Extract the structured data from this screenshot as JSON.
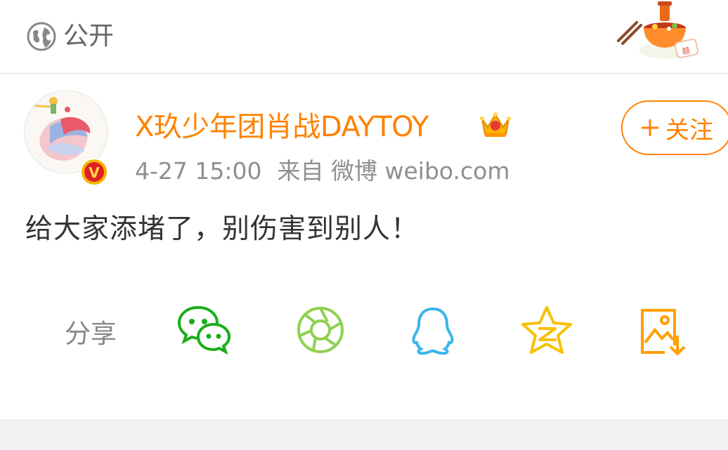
{
  "header": {
    "visibility_icon": "globe-icon",
    "visibility_label": "公开",
    "decoration_icon": "hotpot-icon"
  },
  "post": {
    "username": "X玖少年团肖战DAYTOY",
    "verified_icon": "verified-v-icon",
    "member_icon": "crown-icon",
    "timestamp": "4-27 15:00",
    "source": "来自 微博 weibo.com",
    "follow_label": "关注",
    "follow_icon": "plus-icon",
    "content": "给大家添堵了，别伤害到别人！"
  },
  "share": {
    "label": "分享",
    "targets": [
      {
        "icon": "wechat-icon",
        "color": "#1aad19"
      },
      {
        "icon": "moments-icon",
        "color": "#8fd14f"
      },
      {
        "icon": "qq-icon",
        "color": "#3cb4ea"
      },
      {
        "icon": "qzone-icon",
        "color": "#f7c100"
      },
      {
        "icon": "save-image-icon",
        "color": "#ffa000"
      }
    ]
  },
  "colors": {
    "accent": "#ff8200",
    "meta": "#8f8f8f"
  }
}
